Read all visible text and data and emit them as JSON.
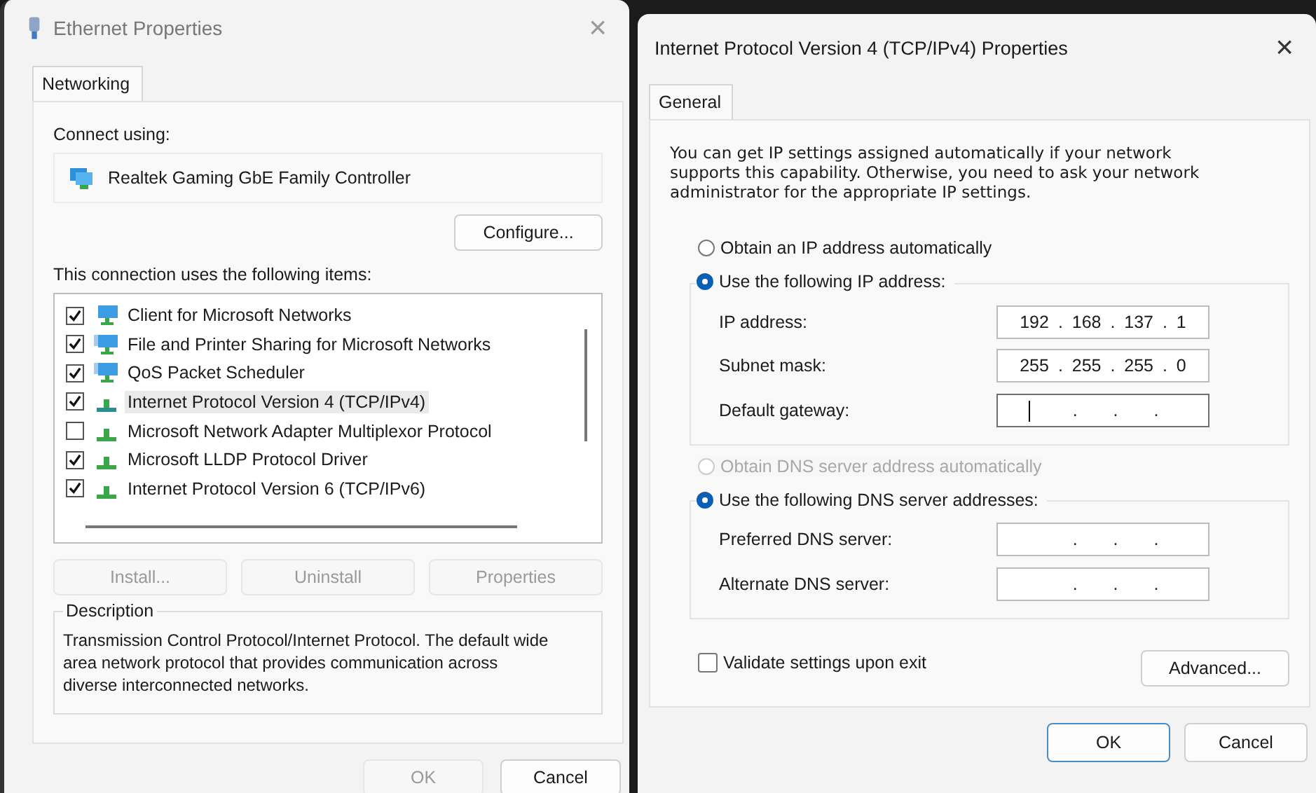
{
  "ethernet_dialog": {
    "title": "Ethernet Properties",
    "close": "×",
    "tabs": [
      {
        "label": "Networking",
        "selected": true
      }
    ],
    "connect_label": "Connect using:",
    "adapter": "Realtek Gaming GbE Family Controller",
    "configure": "Configure...",
    "items_label": "This connection uses the following items:",
    "items": [
      {
        "label": "Client for Microsoft Networks",
        "kind": "client",
        "checked": true,
        "selected": false
      },
      {
        "label": "File and Printer Sharing for Microsoft Networks",
        "kind": "service",
        "checked": true,
        "selected": false
      },
      {
        "label": "QoS Packet Scheduler",
        "kind": "service",
        "checked": true,
        "selected": false
      },
      {
        "label": "Internet Protocol Version 4 (TCP/IPv4)",
        "kind": "protocol",
        "checked": true,
        "selected": true
      },
      {
        "label": "Microsoft Network Adapter Multiplexor Protocol",
        "kind": "protocol",
        "checked": false,
        "selected": false
      },
      {
        "label": "Microsoft LLDP Protocol Driver",
        "kind": "protocol",
        "checked": true,
        "selected": false
      },
      {
        "label": "Internet Protocol Version 6 (TCP/IPv6)",
        "kind": "protocol",
        "checked": true,
        "selected": false
      }
    ],
    "item_buttons": [
      {
        "label": "Install...",
        "disabled": true
      },
      {
        "label": "Uninstall",
        "disabled": true
      },
      {
        "label": "Properties",
        "disabled": true
      }
    ],
    "description": {
      "legend": "Description",
      "text": "Transmission Control Protocol/Internet Protocol. The default wide area network protocol that provides communication across diverse interconnected networks."
    },
    "buttons": [
      {
        "label": "OK",
        "disabled": true
      },
      {
        "label": "Cancel",
        "disabled": false
      }
    ]
  },
  "ipv4_dialog": {
    "title": "Internet Protocol Version 4 (TCP/IPv4) Properties",
    "close": "×",
    "tabs": [
      {
        "label": "General",
        "selected": true
      }
    ],
    "intro": "You can get IP settings assigned automatically if your network supports this capability. Otherwise, you need to ask your network administrator for the appropriate IP settings.",
    "ip_options": [
      {
        "label": "Obtain an IP address automatically",
        "selected": false,
        "disabled": false
      },
      {
        "label": "Use the following IP address:",
        "selected": true,
        "disabled": false
      }
    ],
    "ip_fields": [
      {
        "label": "IP address:",
        "value": "192 . 168 . 137 . 1",
        "focused": false
      },
      {
        "label": "Subnet mask:",
        "value": "255 . 255 . 255 . 0",
        "focused": false
      },
      {
        "label": "Default gateway:",
        "value": ". . .",
        "focused": true
      }
    ],
    "dns_options": [
      {
        "label": "Obtain DNS server address automatically",
        "selected": false,
        "disabled": true
      },
      {
        "label": "Use the following DNS server addresses:",
        "selected": true,
        "disabled": false
      }
    ],
    "dns_fields": [
      {
        "label": "Preferred DNS server:",
        "value": ". . .",
        "focused": false
      },
      {
        "label": "Alternate DNS server:",
        "value": ". . .",
        "focused": false
      }
    ],
    "validate": {
      "label": "Validate settings upon exit",
      "checked": false
    },
    "advanced": "Advanced...",
    "buttons": [
      {
        "label": "OK",
        "default": true
      },
      {
        "label": "Cancel",
        "default": false
      }
    ]
  }
}
